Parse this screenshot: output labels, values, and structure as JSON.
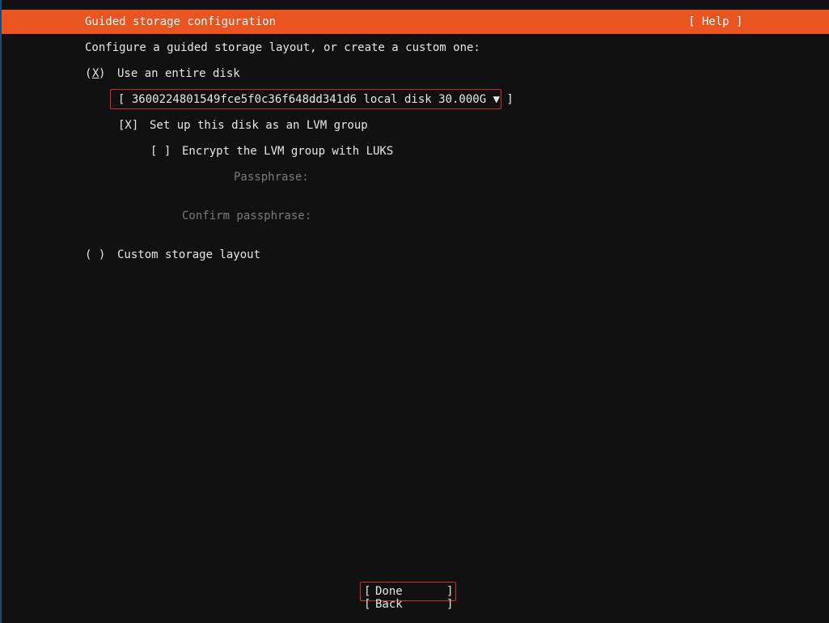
{
  "header": {
    "title": "Guided storage configuration",
    "help_label": "[ Help ]"
  },
  "intro": "Configure a guided storage layout, or create a custom one:",
  "entire_disk": {
    "radio_open": "(",
    "radio_mark": "X",
    "radio_close": ")",
    "label": "Use an entire disk"
  },
  "disk_select": {
    "value": "[ 3600224801549fce5f0c36f648dd341d6 local disk 30.000G ▼ ]"
  },
  "lvm": {
    "checkbox": "[X]",
    "label": "Set up this disk as an LVM group"
  },
  "encrypt": {
    "checkbox": "[ ]",
    "label": "Encrypt the LVM group with LUKS"
  },
  "passphrase_label": "Passphrase:",
  "confirm_passphrase_label": "Confirm passphrase:",
  "custom_layout": {
    "radio": "( )",
    "label": "Custom storage layout"
  },
  "buttons": {
    "done": "Done",
    "back": "Back",
    "open": "[",
    "close": "]"
  }
}
